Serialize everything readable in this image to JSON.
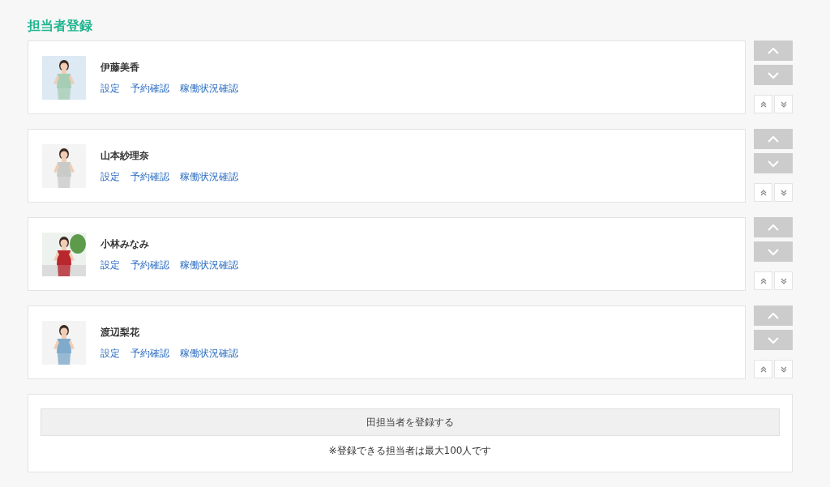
{
  "title": "担当者登録",
  "staff": [
    {
      "name": "伊藤美香",
      "links": [
        "設定",
        "予約確認",
        "稼働状況確認"
      ],
      "picture": {
        "kind": "picture"
      }
    },
    {
      "name": "山本紗理奈",
      "links": [
        "設定",
        "予約確認",
        "稼働状況確認"
      ],
      "picture": {
        "kind": "picture"
      }
    },
    {
      "name": "小林みなみ",
      "links": [
        "設定",
        "予約確認",
        "稼働状況確認"
      ],
      "picture": {
        "kind": "picture"
      }
    },
    {
      "name": "渡辺梨花",
      "links": [
        "設定",
        "予約確認",
        "稼働状況確認"
      ],
      "picture": {
        "kind": "picture"
      }
    }
  ],
  "add_button": "田担当者を登録する",
  "note": "※登録できる担当者は最大100人です"
}
